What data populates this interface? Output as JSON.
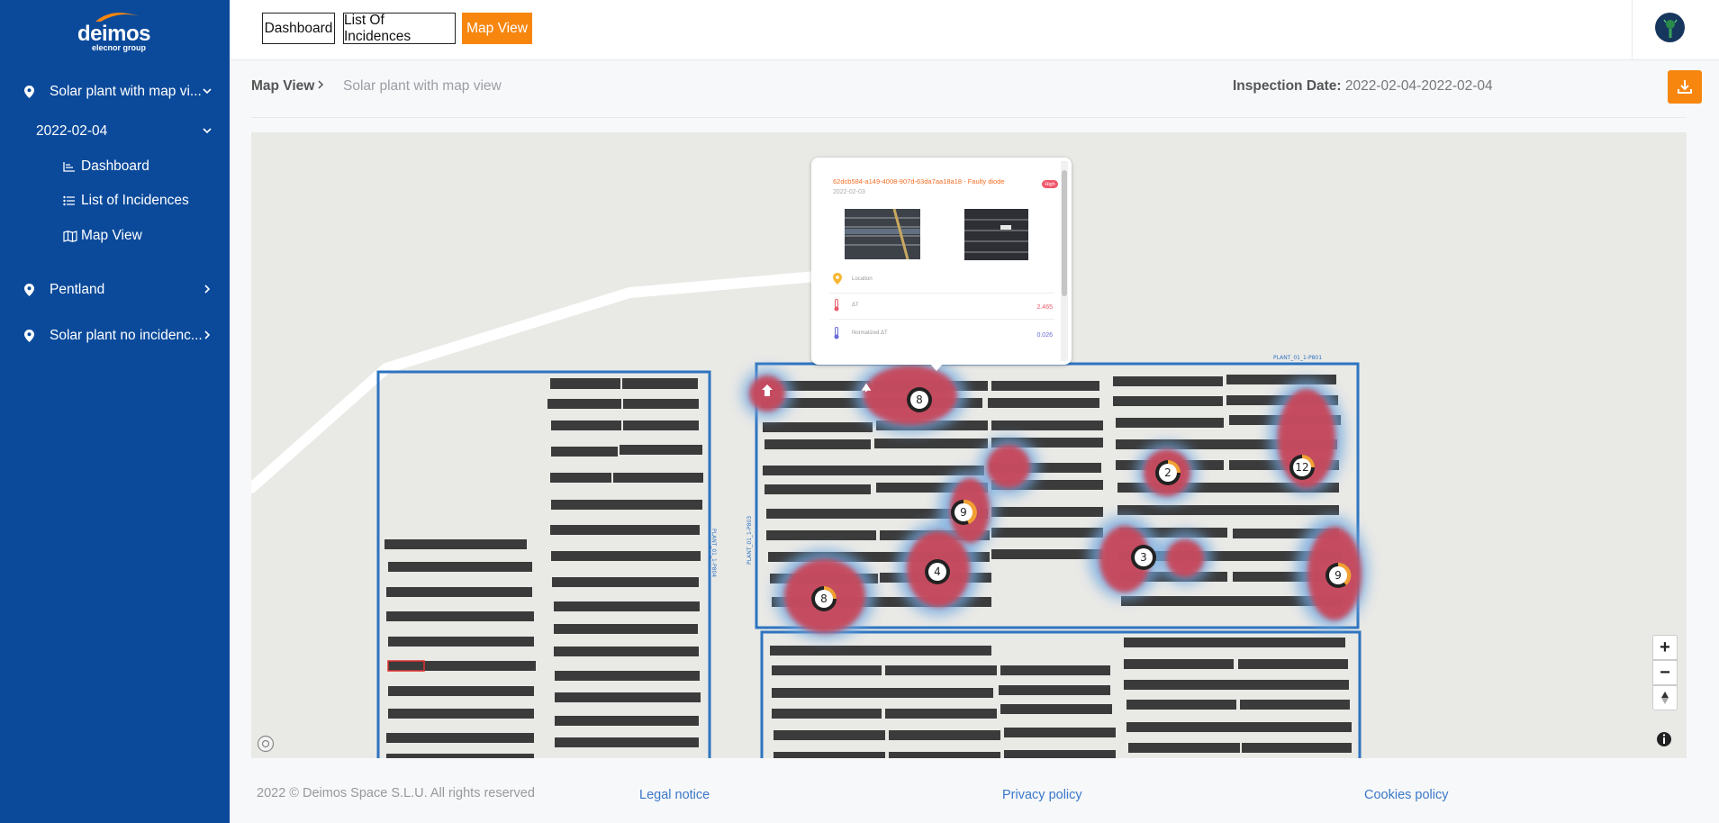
{
  "sidebar": {
    "logo_text": "deimos",
    "logo_subtext": "elecnor group",
    "plants": [
      {
        "label": "Solar plant with map vi..."
      },
      {
        "label": "Pentland"
      },
      {
        "label": "Solar plant no incidenc..."
      }
    ],
    "date_item": "2022-02-04",
    "sub_items": [
      {
        "label": "Dashboard"
      },
      {
        "label": "List of Incidences"
      },
      {
        "label": "Map View"
      }
    ]
  },
  "header": {
    "tabs": [
      {
        "label": "Dashboard"
      },
      {
        "label": "List Of Incidences"
      },
      {
        "label": "Map View"
      }
    ]
  },
  "breadcrumb": {
    "current": "Map View",
    "plant": "Solar plant with map view"
  },
  "inspection": {
    "label": "Inspection Date:",
    "value": "2022-02-04-2022-02-04"
  },
  "map": {
    "popup": {
      "title": "62dcb584-a149-4008-907d-63da7aa18a18 - Faulty diode",
      "date": "2022-02-03",
      "badge": "High",
      "rows": [
        {
          "label": "Location",
          "value": ""
        },
        {
          "label": "ΔT",
          "value": "2.465"
        },
        {
          "label": "Normalized ΔT",
          "value": "0.026"
        }
      ]
    },
    "area_labels": {
      "north": "PLANT_01_1-P801",
      "west": "PLANT_01_1-P804",
      "mid": "PLANT_01_1-P803"
    },
    "clusters": [
      {
        "count": "8"
      },
      {
        "count": "2"
      },
      {
        "count": "12"
      },
      {
        "count": "9"
      },
      {
        "count": "4"
      },
      {
        "count": "3"
      },
      {
        "count": "9"
      },
      {
        "count": "8"
      }
    ],
    "zoom_in": "+",
    "zoom_out": "−"
  },
  "footer": {
    "copyright": "2022 © Deimos Space S.L.U. All rights reserved",
    "links": [
      "Legal notice",
      "Privacy policy",
      "Cookies policy"
    ]
  },
  "colors": {
    "sidebar": "#0b4a9b",
    "accent": "#f7860f",
    "heat": "#c8465a",
    "heat_glow": "#6fa8e0",
    "panel_row": "#3b3b3b",
    "site_border": "#2e74c0"
  }
}
